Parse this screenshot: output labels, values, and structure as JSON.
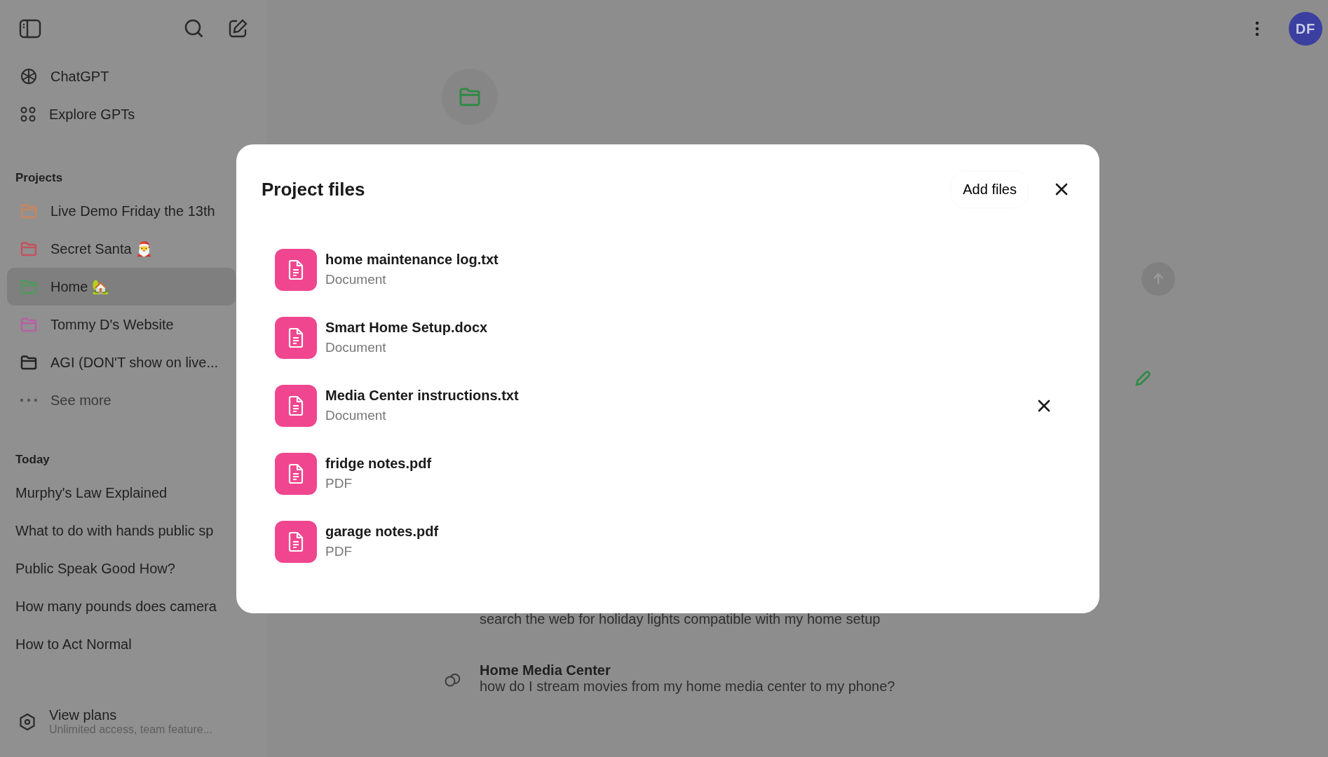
{
  "sidebar": {
    "nav": [
      {
        "kind": "chatgpt",
        "label": "ChatGPT"
      },
      {
        "kind": "explore",
        "label": "Explore GPTs"
      }
    ],
    "projects_heading": "Projects",
    "projects": [
      {
        "label": "Live Demo Friday the 13th",
        "color": "#c9855d",
        "selected": false
      },
      {
        "label": "Secret Santa 🎅",
        "color": "#c4525c",
        "selected": false
      },
      {
        "label": "Home 🏡",
        "color": "#4f9a5c",
        "selected": true
      },
      {
        "label": "Tommy D's Website",
        "color": "#b85fa8",
        "selected": false
      },
      {
        "label": "AGI (DON'T show on live...",
        "color": "#222222",
        "selected": false
      }
    ],
    "see_more": "See more",
    "today_heading": "Today",
    "chats": [
      "Murphy's Law Explained",
      "What to do with hands public sp",
      "Public Speak Good How?",
      "How many pounds does camera",
      "How to Act Normal"
    ],
    "upgrade": {
      "title": "View plans",
      "subtitle": "Unlimited access, team feature..."
    }
  },
  "header": {
    "avatar": "DF"
  },
  "conversations": [
    {
      "subtitle": "search the web for holiday lights compatible with my home setup"
    },
    {
      "title": "Home Media Center",
      "subtitle": "how do I stream movies from my home media center to my phone?"
    }
  ],
  "modal": {
    "title": "Project files",
    "add_button": "Add files",
    "files": [
      {
        "name": "home maintenance log.txt",
        "type": "Document",
        "remove_visible": false
      },
      {
        "name": "Smart Home Setup.docx",
        "type": "Document",
        "remove_visible": false
      },
      {
        "name": "Media Center instructions.txt",
        "type": "Document",
        "remove_visible": true
      },
      {
        "name": "fridge notes.pdf",
        "type": "PDF",
        "remove_visible": false
      },
      {
        "name": "garage notes.pdf",
        "type": "PDF",
        "remove_visible": false
      }
    ]
  }
}
